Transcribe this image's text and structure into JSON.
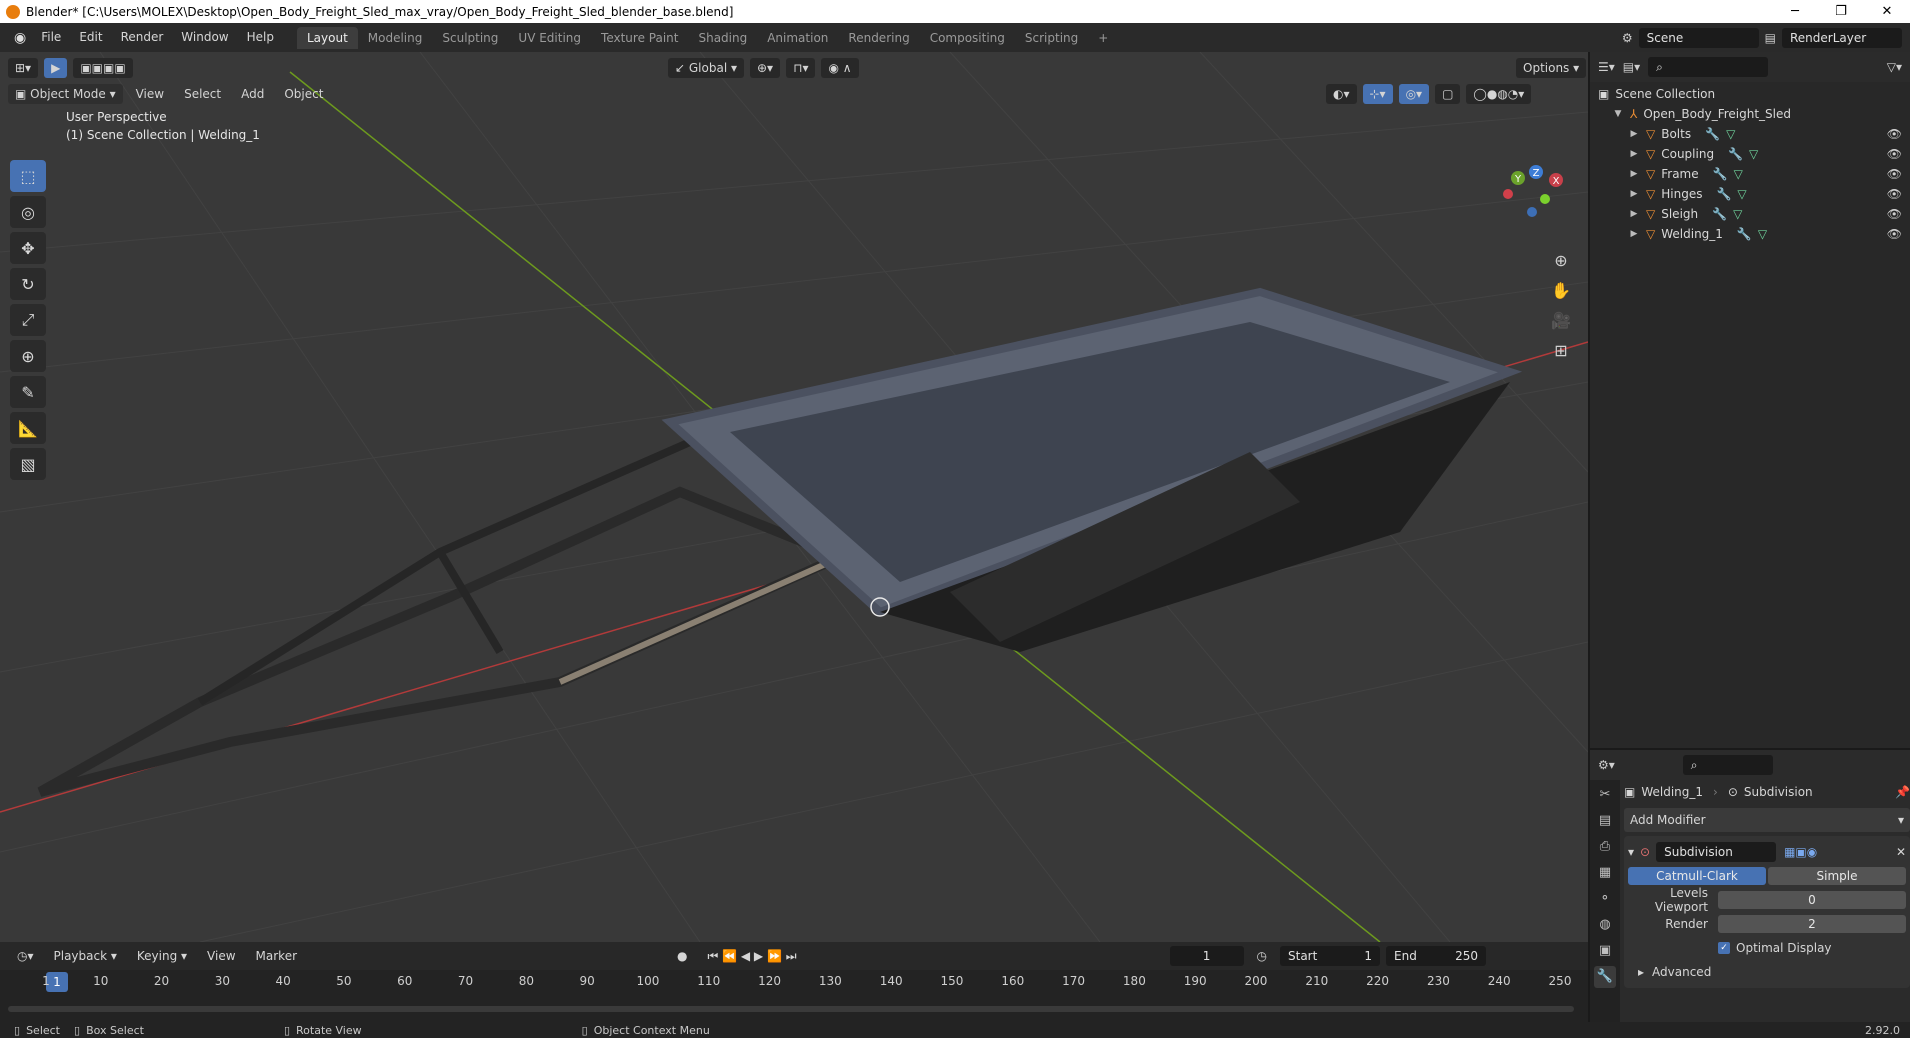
{
  "window": {
    "title": "Blender* [C:\\Users\\MOLEX\\Desktop\\Open_Body_Freight_Sled_max_vray/Open_Body_Freight_Sled_blender_base.blend]"
  },
  "menu": [
    "File",
    "Edit",
    "Render",
    "Window",
    "Help"
  ],
  "workspaces": [
    "Layout",
    "Modeling",
    "Sculpting",
    "UV Editing",
    "Texture Paint",
    "Shading",
    "Animation",
    "Rendering",
    "Compositing",
    "Scripting"
  ],
  "active_workspace": "Layout",
  "scene": {
    "name": "Scene",
    "render_layer": "RenderLayer"
  },
  "viewport": {
    "transform_orientation": "Global",
    "options_label": "Options",
    "mode": "Object Mode",
    "header_menus": [
      "View",
      "Select",
      "Add",
      "Object"
    ],
    "perspective_label": "User Perspective",
    "collection_label": "(1) Scene Collection | Welding_1",
    "gizmo_axes": {
      "x": "X",
      "y": "Y",
      "z": "Z"
    }
  },
  "outliner": {
    "root": "Scene Collection",
    "collection": "Open_Body_Freight_Sled",
    "objects": [
      {
        "name": "Bolts"
      },
      {
        "name": "Coupling"
      },
      {
        "name": "Frame"
      },
      {
        "name": "Hinges"
      },
      {
        "name": "Sleigh"
      },
      {
        "name": "Welding_1"
      }
    ]
  },
  "properties": {
    "object_name": "Welding_1",
    "modifier_context": "Subdivision",
    "add_modifier_label": "Add Modifier",
    "modifier_name": "Subdivision",
    "subdiv_types": [
      "Catmull-Clark",
      "Simple"
    ],
    "active_subdiv_type": "Catmull-Clark",
    "levels_viewport_label": "Levels Viewport",
    "levels_viewport": "0",
    "render_label": "Render",
    "render_levels": "2",
    "optimal_display_label": "Optimal Display",
    "optimal_display_checked": true,
    "advanced_label": "Advanced"
  },
  "timeline": {
    "menus": [
      "Playback",
      "Keying",
      "View",
      "Marker"
    ],
    "current_frame": "1",
    "start_label": "Start",
    "start": "1",
    "end_label": "End",
    "end": "250",
    "ticks": [
      "1",
      "10",
      "20",
      "30",
      "40",
      "50",
      "60",
      "70",
      "80",
      "90",
      "100",
      "110",
      "120",
      "130",
      "140",
      "150",
      "160",
      "170",
      "180",
      "190",
      "200",
      "210",
      "220",
      "230",
      "240",
      "250"
    ]
  },
  "statusbar": {
    "select": "Select",
    "box_select": "Box Select",
    "rotate_view": "Rotate View",
    "context_menu": "Object Context Menu",
    "version": "2.92.0"
  },
  "colors": {
    "accent": "#4772b3",
    "object_icon": "#e88c34",
    "grid_x_axis": "#b23a3a",
    "grid_y_axis": "#6d9a1e"
  }
}
